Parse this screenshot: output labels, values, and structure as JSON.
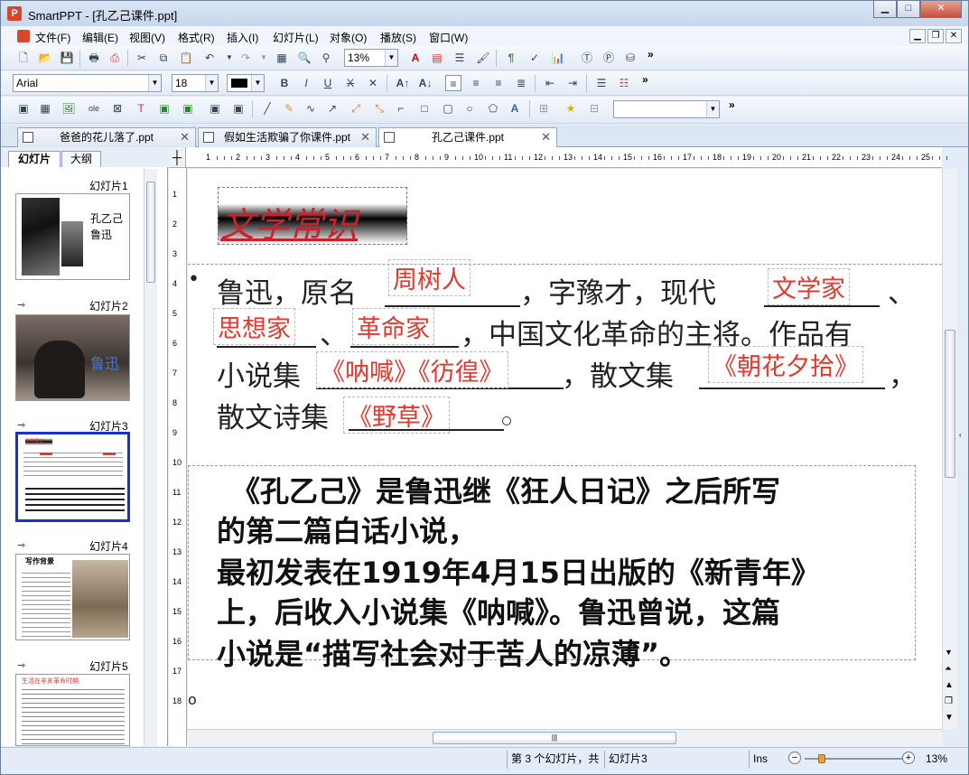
{
  "app": {
    "title": "SmartPPT - [孔乙己课件.ppt]",
    "icon": "P"
  },
  "window_controls": {
    "minimize": "▁",
    "maximize": "□",
    "close": "✕"
  },
  "mdi_controls": {
    "minimize": "▁",
    "restore": "❐",
    "close": "✕"
  },
  "menu": [
    "文件(F)",
    "编辑(E)",
    "视图(V)",
    "格式(R)",
    "插入(I)",
    "幻灯片(L)",
    "对象(O)",
    "播放(S)",
    "窗口(W)"
  ],
  "toolbar1": {
    "zoom_value": "13%",
    "more": "»"
  },
  "toolbar2": {
    "font_name": "Arial",
    "font_size": "18",
    "more": "»"
  },
  "toolbar3": {
    "style_value": "",
    "more": "»"
  },
  "doc_tabs": [
    {
      "label": "爸爸的花儿落了.ppt",
      "close": "✕"
    },
    {
      "label": "假如生活欺骗了你课件.ppt",
      "close": "✕"
    },
    {
      "label": "孔乙己课件.ppt",
      "close": "✕"
    }
  ],
  "pane_tabs": {
    "slides": "幻灯片",
    "outline": "大纲"
  },
  "slides": [
    {
      "label": "幻灯片1",
      "thumb_text": "孔乙己\n鲁迅"
    },
    {
      "label": "幻灯片2",
      "thumb_text": "鲁迅"
    },
    {
      "label": "幻灯片3",
      "thumb_text": "文学常识"
    },
    {
      "label": "幻灯片4",
      "thumb_text": "写作背景"
    },
    {
      "label": "幻灯片5",
      "thumb_text": "生活在辛亥革命时期"
    }
  ],
  "ruler": {
    "h": [
      "1",
      "2",
      "3",
      "4",
      "5",
      "6",
      "7",
      "8",
      "9",
      "10",
      "11",
      "12",
      "13",
      "14",
      "15",
      "16",
      "17",
      "18",
      "19",
      "20",
      "21",
      "22",
      "23",
      "24",
      "25"
    ],
    "v": [
      "1",
      "2",
      "3",
      "4",
      "5",
      "6",
      "7",
      "8",
      "9",
      "10",
      "11",
      "12",
      "13",
      "14",
      "15",
      "16",
      "17",
      "18"
    ]
  },
  "slide": {
    "heading": "文学常识",
    "bullet": "•",
    "line1": {
      "a": "鲁迅，原名",
      "b": "，字豫才，现代",
      "c": "、"
    },
    "line2": {
      "a": "、",
      "b": "，中国文化革命的主将。作品有"
    },
    "line3": {
      "a": "小说集",
      "b": "，散文集",
      "c": "，"
    },
    "line4": {
      "a": "散文诗集"
    },
    "answers": {
      "name": "周树人",
      "writer": "文学家",
      "thinker": "思想家",
      "revolutionary": "革命家",
      "novels": "《呐喊》《彷徨》",
      "essays": "《朝花夕拾》",
      "poems": "《野草》"
    },
    "para2": [
      "　《孔乙己》是鲁迅继《狂人日记》之后所写",
      "的第二篇白话小说，",
      "最初发表在1919年4月15日出版的《新青年》",
      "上，后收入小说集《呐喊》。鲁迅曾说，这篇",
      "小说是“描写社会对于苦人的凉薄”。"
    ],
    "bullet_small": "o"
  },
  "status": {
    "slide_pos": "第 3 个幻灯片，共",
    "slide_name": "幻灯片3",
    "mode": "Ins",
    "zoom": "13%",
    "zoom_level": 0.15
  },
  "colors": {
    "answer_red": "#e8362b",
    "heading_red": "#c8232c",
    "selected_border": "#1a2fd6"
  }
}
